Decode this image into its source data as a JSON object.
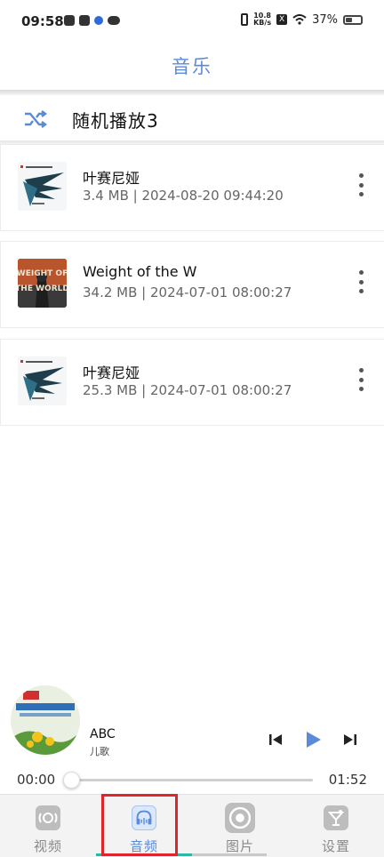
{
  "status_bar": {
    "time": "09:58",
    "net_speed_value": "10.8",
    "net_speed_unit": "KB/s",
    "battery": "37%",
    "extra_icon": "X"
  },
  "header": {
    "title": "音乐"
  },
  "shuffle": {
    "label": "随机播放3",
    "icon": "shuffle-icon",
    "accent": "#5b8ad9"
  },
  "tracks": [
    {
      "title": "叶赛尼娅",
      "size": "3.4 MB",
      "date": "2024-08-20 09:44:20",
      "cover": "wing-art"
    },
    {
      "title": "Weight of the W",
      "size": "34.2 MB",
      "date": "2024-07-01 08:00:27",
      "cover": "weight-of-the-world-art",
      "cover_text": "WEIGHT OF THE WORLD"
    },
    {
      "title": "叶赛尼娅",
      "size": "25.3 MB",
      "date": "2024-07-01 08:00:27",
      "cover": "wing-art"
    }
  ],
  "separator": " | ",
  "now_playing": {
    "title": "ABC",
    "artist": "儿歌",
    "current_time": "00:00",
    "total_time": "01:52",
    "progress": 0.0,
    "play_color": "#5b8ad9"
  },
  "nav": {
    "items": [
      {
        "label": "视频",
        "icon": "video-icon",
        "active": false
      },
      {
        "label": "音频",
        "icon": "headphones-icon",
        "active": true
      },
      {
        "label": "图片",
        "icon": "image-icon",
        "active": false
      },
      {
        "label": "设置",
        "icon": "settings-icon",
        "active": false
      }
    ],
    "active_color": "#2bb9a1",
    "highlight_color": "#e0242b"
  }
}
